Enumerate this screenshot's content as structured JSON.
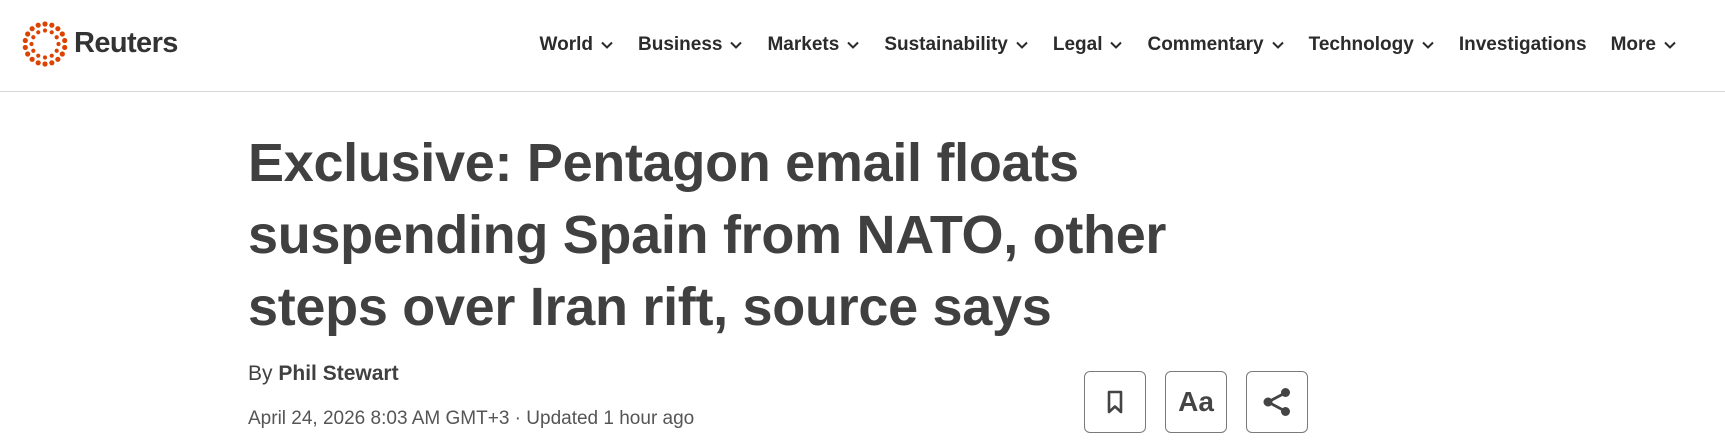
{
  "brand": {
    "name": "Reuters",
    "logo_icon": "reuters-logo-icon",
    "accent": "#dc4300"
  },
  "nav": {
    "items": [
      {
        "label": "World",
        "dropdown": true
      },
      {
        "label": "Business",
        "dropdown": true
      },
      {
        "label": "Markets",
        "dropdown": true
      },
      {
        "label": "Sustainability",
        "dropdown": true
      },
      {
        "label": "Legal",
        "dropdown": true
      },
      {
        "label": "Commentary",
        "dropdown": true
      },
      {
        "label": "Technology",
        "dropdown": true
      },
      {
        "label": "Investigations",
        "dropdown": false
      },
      {
        "label": "More",
        "dropdown": true
      }
    ]
  },
  "article": {
    "headline_lines": [
      "Exclusive: Pentagon email floats",
      "suspending Spain from NATO, other",
      "steps over Iran rift, source says"
    ],
    "byline_prefix": "By",
    "author": "Phil Stewart",
    "date": "April 24, 2026 8:03 AM GMT+3",
    "separator": "·",
    "updated": "Updated 1 hour ago"
  },
  "tools": {
    "bookmark_icon": "bookmark-icon",
    "font_size_label": "Aa",
    "share_icon": "share-icon"
  }
}
